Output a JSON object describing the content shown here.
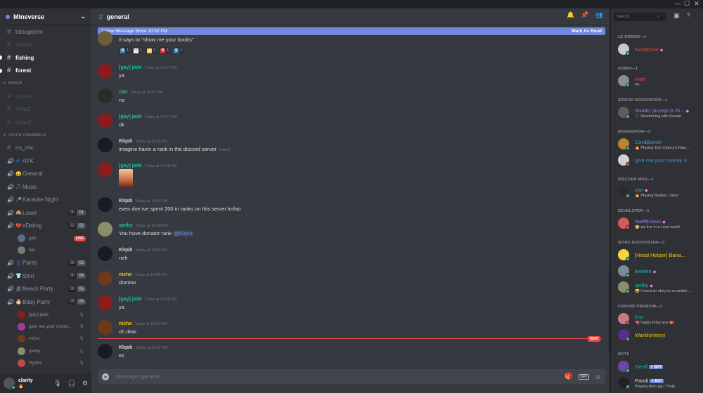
{
  "window": {
    "minimize": "—",
    "maximize": "☐",
    "close": "✕"
  },
  "server": {
    "name": "Mineverse",
    "chevron": "⌄"
  },
  "channels_top": [
    {
      "name": "tatsugotchi",
      "state": "normal"
    },
    {
      "name": "casino",
      "state": "muted"
    },
    {
      "name": "fishing",
      "state": "unread"
    },
    {
      "name": "forest",
      "state": "unread"
    }
  ],
  "categories": {
    "miner": "MINER",
    "voice": "VOICE CHANNELS"
  },
  "channels_miner": [
    {
      "name": "miner1"
    },
    {
      "name": "mine2"
    },
    {
      "name": "mine3"
    }
  ],
  "voice": {
    "no_mic": "no_mic",
    "channels": [
      {
        "emoji": "💤",
        "name": "AFK"
      },
      {
        "emoji": "😀",
        "name": "General"
      },
      {
        "emoji": "🎵",
        "name": "Music"
      },
      {
        "emoji": "🎤",
        "name": "Karaoke Night"
      },
      {
        "emoji": "🙈",
        "name": "Loser",
        "count": [
          "00",
          "01"
        ]
      },
      {
        "emoji": "💔",
        "name": "eDating",
        "count": [
          "02",
          "02"
        ]
      },
      {
        "emoji": "👖",
        "name": "Pants",
        "count": [
          "00",
          "03"
        ]
      },
      {
        "emoji": "👕",
        "name": "Shirt",
        "count": [
          "00",
          "04"
        ]
      },
      {
        "emoji": "🏖",
        "name": "Beach Party",
        "count": [
          "00",
          "05"
        ]
      },
      {
        "emoji": "🎂",
        "name": "Bday Party",
        "count": [
          "05",
          "06"
        ]
      }
    ],
    "edating_users": [
      {
        "name": "gab",
        "badge": "LIVE"
      },
      {
        "name": "tak"
      }
    ],
    "bday_users": [
      {
        "name": "[gay] jade"
      },
      {
        "name": "give me your mone..."
      },
      {
        "name": "nicho"
      },
      {
        "name": "qwiby"
      },
      {
        "name": "Rythm"
      }
    ]
  },
  "user": {
    "name": "clarity",
    "sub": "🔥"
  },
  "channel": {
    "title": "general"
  },
  "new_banner": {
    "text": "1 New Message Since 10:52 PM",
    "action": "Mark As Read"
  },
  "messages": [
    {
      "author": "",
      "time": "",
      "text": "It says to \"show me your boobs\"",
      "avatar": "#6b5d3a"
    },
    {
      "author": "[gay] jade",
      "color": "#1abc9c",
      "time": "Today at 10:47 PM",
      "text": "ya",
      "avatar": "#8a1c1c"
    },
    {
      "author": "clar",
      "color": "#43b581",
      "time": "Today at 10:47 PM",
      "text": "no",
      "avatar": "#2b2b2b"
    },
    {
      "author": "[gay] jade",
      "color": "#1abc9c",
      "time": "Today at 10:47 PM",
      "text": "ok",
      "avatar": "#8a1c1c"
    },
    {
      "author": "Klqsh",
      "color": "#dcddde",
      "time": "Today at 10:49 PM",
      "text": "imagine havin a rank in the discord server",
      "edited": "(edited)",
      "avatar": "#1a1a24"
    },
    {
      "author": "[gay] jade",
      "color": "#1abc9c",
      "time": "Today at 10:49 PM",
      "text": "",
      "avatar": "#8a1c1c"
    },
    {
      "author": "Klqsh",
      "color": "#dcddde",
      "time": "Today at 10:49 PM",
      "text": "even doe ive spent 200 in ranks on this server lmfao",
      "avatar": "#1a1a24"
    },
    {
      "author": "qwiby",
      "color": "#1abc9c",
      "time": "Today at 10:50 PM",
      "text": "You have donator rank ",
      "mention": "@Klqsh",
      "avatar": "#8a8f6a"
    },
    {
      "author": "Klqsh",
      "color": "#dcddde",
      "time": "Today at 10:50 PM",
      "text": "neh",
      "avatar": "#1a1a24"
    },
    {
      "author": "nicho",
      "color": "#f1c40f",
      "time": "Today at 10:50 PM",
      "text": "domino",
      "avatar": "#6b3a1c"
    },
    {
      "author": "[gay] jade",
      "color": "#1abc9c",
      "time": "Today at 10:50 PM",
      "text": "ya",
      "avatar": "#8a1c1c"
    },
    {
      "author": "nicho",
      "color": "#f1c40f",
      "time": "Today at 10:51 PM",
      "text": "oh dear",
      "avatar": "#6b3a1c"
    },
    {
      "author": "Klqsh",
      "color": "#dcddde",
      "time": "Today at 10:52 PM",
      "text": "ez",
      "avatar": "#1a1a24"
    }
  ],
  "reactions": [
    {
      "letter": "B",
      "color": "#3b88c3",
      "count": "1"
    },
    {
      "letter": "⚾",
      "color": "#ffffff",
      "count": "1"
    },
    {
      "letter": "●",
      "color": "#fdcb58",
      "count": "1"
    },
    {
      "letter": "B",
      "color": "#dd2e44",
      "count": "1"
    },
    {
      "letter": "S",
      "color": "#3b88c3",
      "count": "1"
    }
  ],
  "new_separator": "NEW",
  "composer": {
    "placeholder": "Message #general",
    "plus": "+",
    "gif": "GIF"
  },
  "members": {
    "search_placeholder": "Search",
    "groups": [
      {
        "label": "LE OWNER—1",
        "members": [
          {
            "name": "Noobcrew",
            "color": "#e74c3c",
            "nitro": "◆",
            "avatar": "#c9c9c9",
            "status": "#43b581"
          }
        ]
      },
      {
        "label": "ADMIN—1",
        "members": [
          {
            "name": "matt",
            "color": "#e74c3c",
            "activity": "🎮",
            "avatar": "#8d8d8d",
            "status": "#43b581"
          }
        ]
      },
      {
        "label": "SENIOR MODERATOR—1",
        "members": [
          {
            "name": "Snado (accept is th...",
            "color": "#9b84ec",
            "nitro": "◆",
            "activity": "🎵 Weathering with Accept",
            "avatar": "#5d5d5d",
            "status": "#43b581"
          }
        ]
      },
      {
        "label": "MODERATOR—2",
        "members": [
          {
            "name": "CordBorket",
            "color": "#3498db",
            "activity": "🔥 Playing Tom Clancy's Rain...",
            "avatar": "#b8862e",
            "status": "#43b581"
          },
          {
            "name": "give me your money o...",
            "color": "#3498db",
            "avatar": "#d0d0d0",
            "status": "#f04747"
          }
        ]
      },
      {
        "label": "DISCORD MOD—1",
        "members": [
          {
            "name": "clar",
            "color": "#1abc9c",
            "nitro": "◆",
            "activity": "🔥 Playing Badlion Client",
            "avatar": "#2b2b2b",
            "status": "#43b581"
          }
        ]
      },
      {
        "label": "DEVELOPER—1",
        "members": [
          {
            "name": "Swiftlicious",
            "color": "#9b84ec",
            "nitro": "◆",
            "activity": "🥺 we live in a cruel world",
            "avatar": "#d65a5a",
            "status": "#f04747"
          }
        ]
      },
      {
        "label": "NITRO BOOOOSTER—3",
        "members": [
          {
            "name": "[Head Helper] Bana...",
            "color": "#f1c40f",
            "avatar": "#f5d442",
            "status": "#43b581"
          },
          {
            "name": "leewee",
            "color": "#1abc9c",
            "nitro": "◆",
            "avatar": "#7a8c9a",
            "status": "#43b581"
          },
          {
            "name": "qwiby",
            "color": "#1abc9c",
            "nitro": "◆",
            "activity": "😅 I need an obey to scramble ...",
            "avatar": "#8a8f6a",
            "status": "#43b581"
          }
        ]
      },
      {
        "label": "FORUMS PREMIUM—2",
        "members": [
          {
            "name": "tina",
            "color": "#1abc9c",
            "activity": "💘 happy bday ana 🎁",
            "avatar": "#c97b84",
            "status": "#f04747"
          },
          {
            "name": "WarMonkeyx",
            "color": "#f1c40f",
            "avatar": "#5c2d91",
            "status": "#43b581"
          }
        ]
      },
      {
        "label": "BOTS",
        "members": [
          {
            "name": "Geoff",
            "color": "#1abc9c",
            "bot": "✔ BOT",
            "avatar": "#6a4a9a",
            "status": "#43b581"
          },
          {
            "name": "Pandi",
            "color": "#dcddde",
            "bot": "✔ BOT",
            "activity": "Playing dyno.gg | ?help",
            "avatar": "#222",
            "status": "#43b581"
          }
        ]
      }
    ]
  }
}
